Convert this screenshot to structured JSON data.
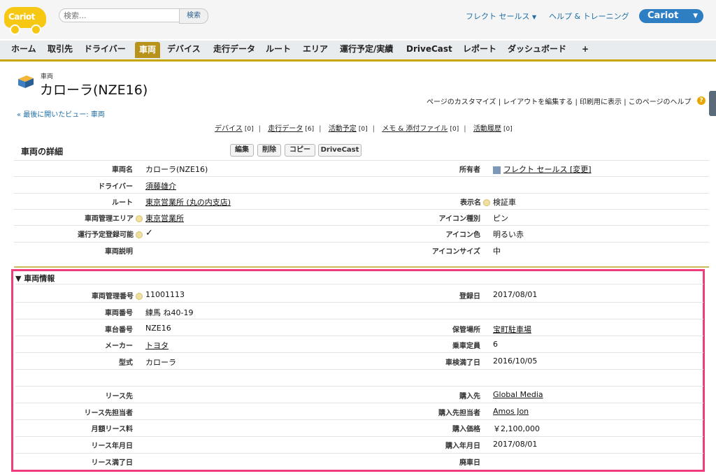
{
  "header": {
    "logo_text": "Cariot",
    "search_placeholder": "検索...",
    "search_button": "検索",
    "user_menu": "フレクト セールス",
    "help_link": "ヘルプ & トレーニング",
    "app_menu": "Cariot"
  },
  "tabs": [
    "ホーム",
    "取引先",
    "ドライバー",
    "車両",
    "デバイス",
    "走行データ",
    "ルート",
    "エリア",
    "運行予定/実績",
    "DriveCast",
    "レポート",
    "ダッシュボード",
    "+"
  ],
  "active_tab": "車両",
  "record": {
    "object_type": "車両",
    "title": "カローラ(NZE16)",
    "back_link": "« 最後に開いたビュー: 車両",
    "page_links": [
      "ページのカスタマイズ",
      "レイアウトを編集する",
      "印刷用に表示",
      "このページのヘルプ"
    ]
  },
  "related_lists": [
    {
      "label": "デバイス",
      "count": "[0]"
    },
    {
      "label": "走行データ",
      "count": "[6]"
    },
    {
      "label": "活動予定",
      "count": "[0]"
    },
    {
      "label": "メモ & 添付ファイル",
      "count": "[0]"
    },
    {
      "label": "活動履歴",
      "count": "[0]"
    }
  ],
  "detail": {
    "title": "車両の詳細",
    "buttons": [
      "編集",
      "削除",
      "コピー",
      "DriveCast"
    ],
    "rows": [
      {
        "left_label": "車両名",
        "left_value": "カローラ(NZE16)",
        "right_label": "所有者",
        "right_value": "フレクト セールス [変更]"
      },
      {
        "left_label": "ドライバー",
        "left_value": "須藤雄介",
        "right_label": "",
        "right_value": ""
      },
      {
        "left_label": "ルート",
        "left_value": "東京営業所 (丸の内支店)",
        "right_label": "表示名",
        "right_value": "検証車"
      },
      {
        "left_label": "車両管理エリア",
        "left_value": "東京営業所",
        "right_label": "アイコン種別",
        "right_value": "ピン"
      },
      {
        "left_label": "運行予定登録可能",
        "left_value": "✓",
        "right_label": "アイコン色",
        "right_value": "明るい赤"
      },
      {
        "left_label": "車両説明",
        "left_value": "",
        "right_label": "アイコンサイズ",
        "right_value": "中"
      }
    ]
  },
  "vehicle_info": {
    "title": "▼ 車両情報",
    "rows": [
      {
        "left_label": "車両管理番号",
        "left_value": "11001113",
        "right_label": "登録日",
        "right_value": "2017/08/01"
      },
      {
        "left_label": "車両番号",
        "left_value": "練馬 ね40-19",
        "right_label": "",
        "right_value": ""
      },
      {
        "left_label": "車台番号",
        "left_value": "NZE16",
        "right_label": "保管場所",
        "right_value": "宝町駐車場"
      },
      {
        "left_label": "メーカー",
        "left_value": "トヨタ",
        "right_label": "乗車定員",
        "right_value": "6"
      },
      {
        "left_label": "型式",
        "left_value": "カローラ",
        "right_label": "車検満了日",
        "right_value": "2016/10/05"
      },
      {
        "left_label": "",
        "left_value": "",
        "right_label": "",
        "right_value": ""
      },
      {
        "left_label": "リース先",
        "left_value": "",
        "right_label": "購入先",
        "right_value": "Global Media"
      },
      {
        "left_label": "リース先担当者",
        "left_value": "",
        "right_label": "購入先担当者",
        "right_value": "Amos Jon"
      },
      {
        "left_label": "月額リース料",
        "left_value": "",
        "right_label": "購入価格",
        "right_value": "￥2,100,000"
      },
      {
        "left_label": "リース年月日",
        "left_value": "",
        "right_label": "購入年月日",
        "right_value": "2017/08/01"
      },
      {
        "left_label": "リース満了日",
        "left_value": "",
        "right_label": "廃車日",
        "right_value": ""
      }
    ]
  },
  "colors": {
    "accent": "#b8931c",
    "highlight": "#ee3d7c",
    "link": "#1f6ea5",
    "app_button": "#2e7ec3"
  }
}
